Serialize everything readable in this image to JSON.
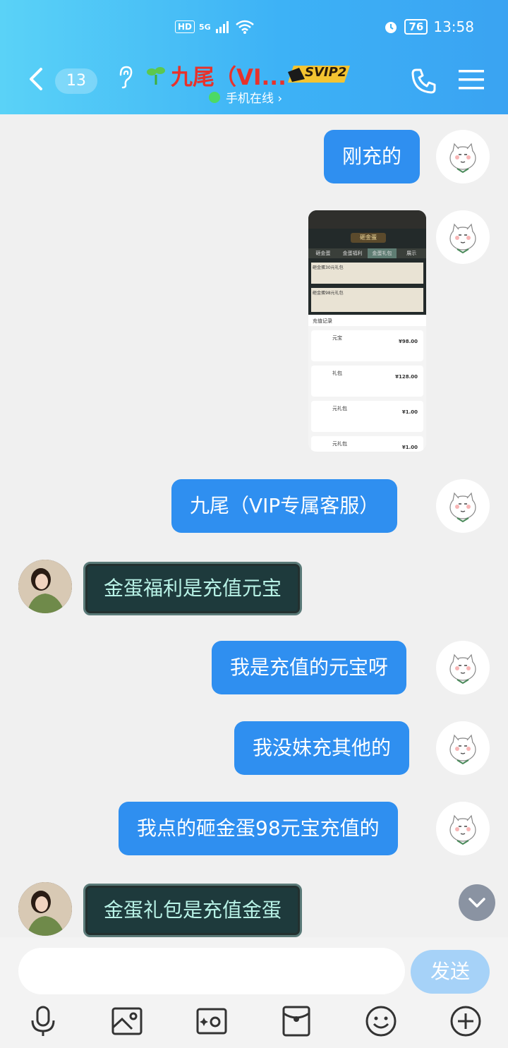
{
  "status_bar": {
    "hd": "HD",
    "net": "5G",
    "battery": "76",
    "time": "13:58"
  },
  "header": {
    "unread_count": "13",
    "title": "九尾（VI...",
    "badge": "SVIP2",
    "subtitle": "手机在线 ›"
  },
  "messages": [
    {
      "side": "me",
      "type": "text",
      "text": "刚充的"
    },
    {
      "side": "me",
      "type": "image"
    },
    {
      "side": "me",
      "type": "text",
      "text": "九尾（VIP专属客服）"
    },
    {
      "side": "other",
      "type": "text",
      "text": "金蛋福利是充值元宝"
    },
    {
      "side": "me",
      "type": "text",
      "text": "我是充值的元宝呀"
    },
    {
      "side": "me",
      "type": "text",
      "text": "我没妹充其他的"
    },
    {
      "side": "me",
      "type": "text",
      "text": "我点的砸金蛋98元宝充值的"
    },
    {
      "side": "other",
      "type": "text",
      "text": "金蛋礼包是充值金蛋"
    }
  ],
  "screenshot": {
    "tabs": [
      "砸金蛋",
      "金蛋福利",
      "金蛋礼包",
      "展示"
    ],
    "banner": "砸金蛋",
    "packs": [
      "砸金蛋30元礼包",
      "砸金蛋98元礼包"
    ],
    "records_title": "充值记录",
    "records": [
      {
        "name": "元宝",
        "amount": "¥98.00"
      },
      {
        "name": "礼包",
        "amount": "¥128.00"
      },
      {
        "name": "元礼包",
        "amount": "¥1.00"
      },
      {
        "name": "元礼包",
        "amount": "¥1.00"
      }
    ]
  },
  "input": {
    "placeholder": "",
    "send_label": "发送"
  },
  "colors": {
    "bubble": "#2f8ff0",
    "header_start": "#5ad2f7",
    "header_end": "#3aa3f2",
    "title": "#e8322b",
    "send": "#a6d2f8"
  }
}
